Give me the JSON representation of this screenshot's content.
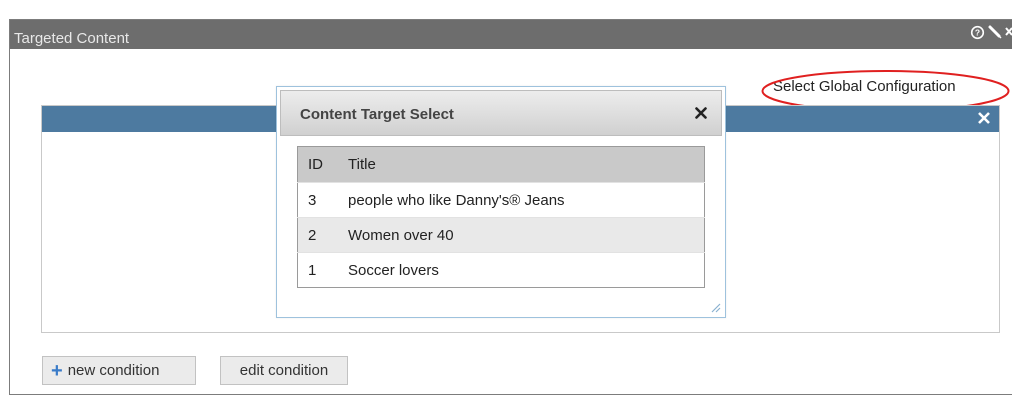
{
  "portlet": {
    "title": "Targeted Content",
    "icons": [
      "help-icon",
      "edit-icon",
      "close-icon"
    ]
  },
  "global_config_link": "Select Global Configuration",
  "dialog": {
    "title": "Content Target Select",
    "columns": {
      "id": "ID",
      "title": "Title"
    },
    "rows": [
      {
        "id": "3",
        "title": "people who like Danny's® Jeans"
      },
      {
        "id": "2",
        "title": "Women over 40"
      },
      {
        "id": "1",
        "title": "Soccer lovers"
      }
    ]
  },
  "buttons": {
    "new_condition": "new condition",
    "edit_condition": "edit condition"
  },
  "colors": {
    "portlet_header": "#6d6d6d",
    "inner_bar": "#4d7aa0",
    "highlight": "#e02020"
  }
}
